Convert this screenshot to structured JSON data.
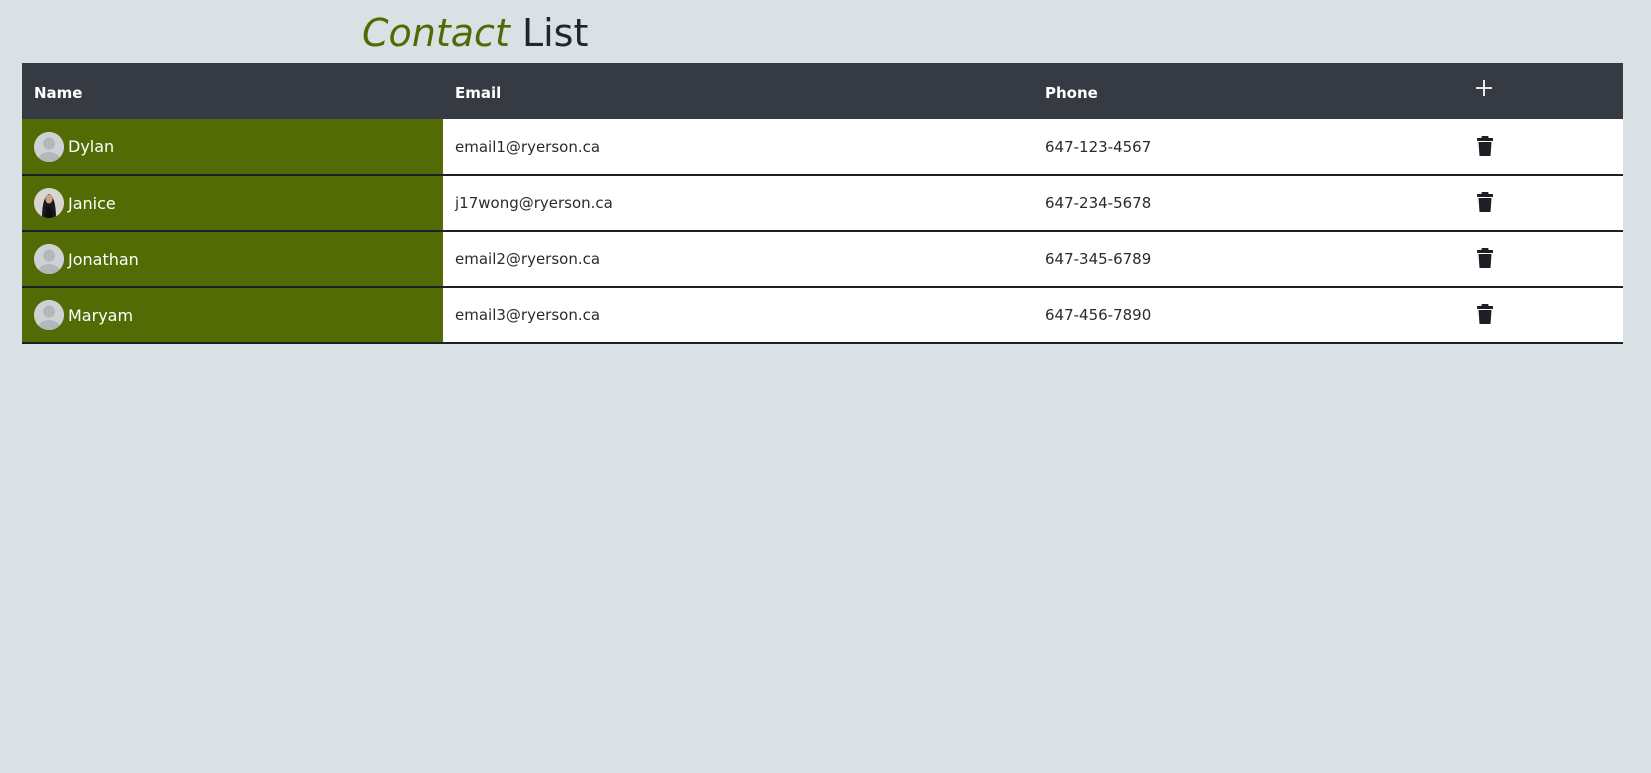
{
  "page_title": {
    "accent": "Contact",
    "rest": "List"
  },
  "table": {
    "headers": {
      "name": "Name",
      "email": "Email",
      "phone": "Phone"
    },
    "add_icon": "plus-icon",
    "delete_icon": "trash-icon",
    "rows": [
      {
        "name": "Dylan",
        "email": "email1@ryerson.ca",
        "phone": "647-123-4567",
        "avatar": "default-avatar"
      },
      {
        "name": "Janice",
        "email": "j17wong@ryerson.ca",
        "phone": "647-234-5678",
        "avatar": "photo-avatar"
      },
      {
        "name": "Jonathan",
        "email": "email2@ryerson.ca",
        "phone": "647-345-6789",
        "avatar": "default-avatar"
      },
      {
        "name": "Maryam",
        "email": "email3@ryerson.ca",
        "phone": "647-456-7890",
        "avatar": "default-avatar"
      }
    ]
  },
  "colors": {
    "background": "#d9e1e4",
    "accent_green": "#526b05",
    "header_dark": "#363a42",
    "title_text": "#23252b"
  }
}
